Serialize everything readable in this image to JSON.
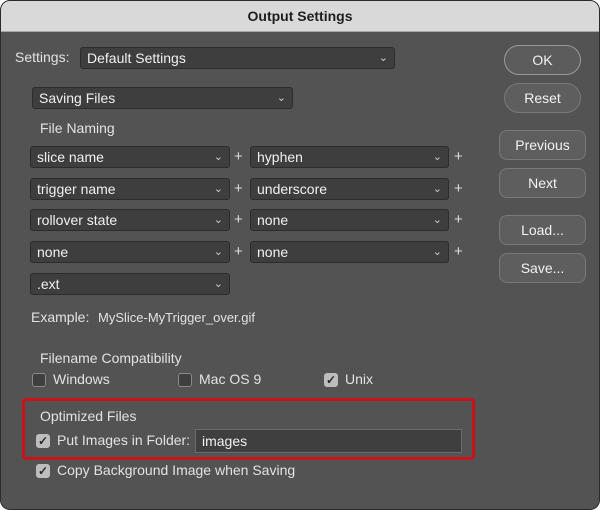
{
  "window": {
    "title": "Output Settings"
  },
  "settings": {
    "label": "Settings:",
    "value": "Default Settings"
  },
  "category": {
    "value": "Saving Files"
  },
  "file_naming": {
    "heading": "File Naming",
    "rows": [
      {
        "left": "slice name",
        "right": "hyphen"
      },
      {
        "left": "trigger name",
        "right": "underscore"
      },
      {
        "left": "rollover state",
        "right": "none"
      },
      {
        "left": "none",
        "right": "none"
      }
    ],
    "extension": ".ext",
    "plus": "+"
  },
  "example": {
    "label": "Example:",
    "value": "MySlice-MyTrigger_over.gif"
  },
  "compatibility": {
    "heading": "Filename Compatibility",
    "options": [
      {
        "label": "Windows",
        "checked": false
      },
      {
        "label": "Mac OS 9",
        "checked": false
      },
      {
        "label": "Unix",
        "checked": true
      }
    ]
  },
  "optimized": {
    "heading": "Optimized Files",
    "put_images_label": "Put Images in Folder:",
    "put_images_checked": true,
    "folder": "images",
    "copy_bg_label": "Copy Background Image when Saving",
    "copy_bg_checked": true
  },
  "buttons": {
    "ok": "OK",
    "reset": "Reset",
    "previous": "Previous",
    "next": "Next",
    "load": "Load...",
    "save": "Save..."
  },
  "icons": {
    "chevron": "chevron-down-icon",
    "check": "checkmark-icon"
  },
  "colors": {
    "highlight": "#c9121a",
    "panel": "#535353",
    "titlebar": "#d9d9d9"
  }
}
